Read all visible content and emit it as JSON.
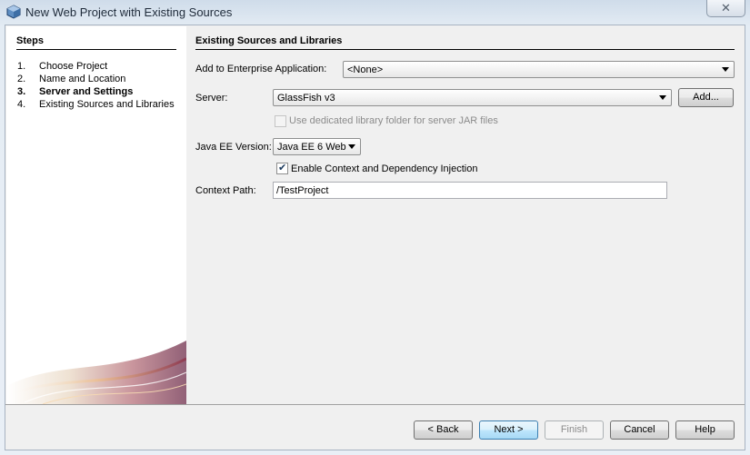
{
  "window": {
    "title": "New Web Project with Existing Sources",
    "close_glyph": "✕"
  },
  "steps": {
    "title": "Steps",
    "items": [
      {
        "num": "1.",
        "label": "Choose Project"
      },
      {
        "num": "2.",
        "label": "Name and Location"
      },
      {
        "num": "3.",
        "label": "Server and Settings",
        "current": true
      },
      {
        "num": "4.",
        "label": "Existing Sources and Libraries"
      }
    ]
  },
  "content": {
    "title": "Existing Sources and Libraries",
    "enterprise_label": "Add to Enterprise Application:",
    "enterprise_value": "<None>",
    "server_label": "Server:",
    "server_value": "GlassFish v3",
    "add_label": "Add...",
    "library_folder_label": "Use dedicated library folder for server JAR files",
    "javaee_label": "Java EE Version:",
    "javaee_value": "Java EE 6 Web",
    "cdi_label": "Enable Context and Dependency Injection",
    "cdi_check": "✔",
    "context_label": "Context Path:",
    "context_value": "/TestProject"
  },
  "buttons": {
    "back": "< Back",
    "next": "Next >",
    "finish": "Finish",
    "cancel": "Cancel",
    "help": "Help"
  },
  "icons": {
    "app": "netbeans-cube-icon"
  }
}
